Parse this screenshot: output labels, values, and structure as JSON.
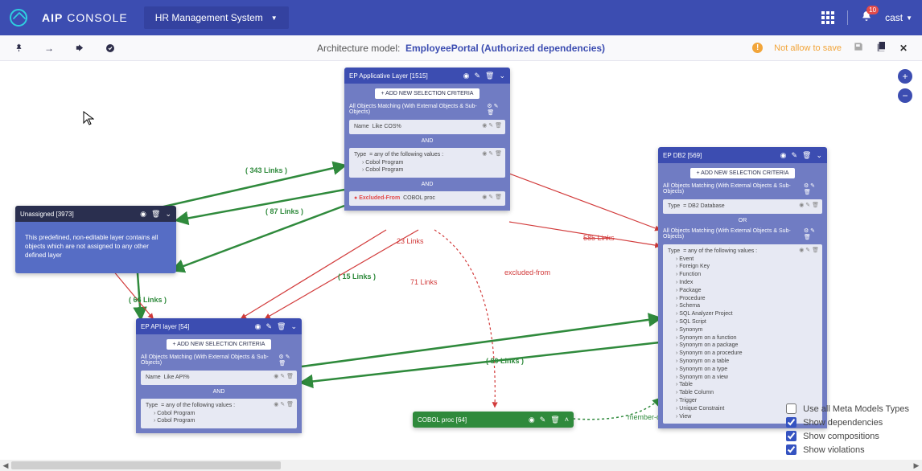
{
  "brand_a": "AIP",
  "brand_b": "CONSOLE",
  "project": "HR Management System",
  "notif_count": "10",
  "user": "cast",
  "subbar": {
    "label": "Architecture model:",
    "model": "EmployeePortal (Authorized dependencies)",
    "warning": "Not allow to save"
  },
  "add_btn": "+ ADD NEW SELECTION CRITERIA",
  "matching": "All Objects Matching (With External Objects & Sub-Objects)",
  "and": "AND",
  "or": "OR",
  "legend": {
    "meta": "Use all Meta Models Types",
    "deps": "Show dependencies",
    "comp": "Show compositions",
    "viol": "Show violations"
  },
  "unassigned": {
    "title": "Unassigned [3973]",
    "text": "This predefined, non-editable layer contains all objects which are not assigned to any other defined layer"
  },
  "app_layer": {
    "title": "EP Applicative Layer [1515]",
    "name_label": "Name",
    "name_val": "Like COS%",
    "type_label": "Type",
    "type_cond": "= any of the following values :",
    "type_vals": [
      "Cobol Program",
      "Cobol Program"
    ],
    "excl_label": "Excluded-From",
    "excl_val": "COBOL proc"
  },
  "api_layer": {
    "title": "EP API layer [54]",
    "name_label": "Name",
    "name_val": "Like API%",
    "type_label": "Type",
    "type_cond": "= any of the following values :",
    "type_vals": [
      "Cobol Program",
      "Cobol Program"
    ]
  },
  "cobol_proc": {
    "title": "COBOL proc [64]"
  },
  "db2": {
    "title": "EP DB2 [569]",
    "type_label": "Type",
    "type_simple": "= DB2 Database",
    "type_cond": "= any of the following values :",
    "type_vals": [
      "Event",
      "Foreign Key",
      "Function",
      "Index",
      "Package",
      "Procedure",
      "Schema",
      "SQL Analyzer Project",
      "SQL Script",
      "Synonym",
      "Synonym on a function",
      "Synonym on a package",
      "Synonym on a procedure",
      "Synonym on a table",
      "Synonym on a type",
      "Synonym on a view",
      "Table",
      "Table Column",
      "Trigger",
      "Unique Constraint",
      "View"
    ]
  },
  "links": {
    "l343": "( 343 Links )",
    "l87": "( 87 Links )",
    "l15": "( 15 Links )",
    "l66": "( 66 Links )",
    "l23": "23 Links",
    "l71": "71 Links",
    "l80": "( 80 Links )",
    "l585": "585 Links",
    "excl": "excluded-from",
    "memb": "member-of"
  }
}
